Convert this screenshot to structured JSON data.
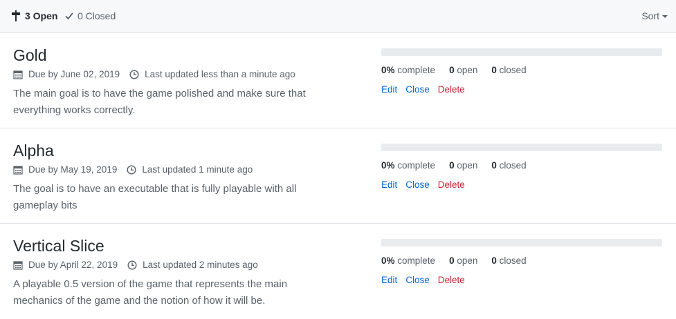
{
  "header": {
    "open_label": "3 Open",
    "closed_label": "0 Closed",
    "sort_label": "Sort"
  },
  "milestones": [
    {
      "title": "Gold",
      "due": "Due by June 02, 2019",
      "updated": "Last updated less than a minute ago",
      "description": "The main goal is to have the game polished and make sure that everything works correctly.",
      "progress": 0,
      "percent_label": "0%",
      "complete_label": "complete",
      "open_count": "0",
      "open_label": "open",
      "closed_count": "0",
      "closed_label": "closed",
      "edit": "Edit",
      "close": "Close",
      "delete": "Delete"
    },
    {
      "title": "Alpha",
      "due": "Due by May 19, 2019",
      "updated": "Last updated 1 minute ago",
      "description": "The goal is to have an executable that is fully playable with all gameplay bits",
      "progress": 0,
      "percent_label": "0%",
      "complete_label": "complete",
      "open_count": "0",
      "open_label": "open",
      "closed_count": "0",
      "closed_label": "closed",
      "edit": "Edit",
      "close": "Close",
      "delete": "Delete"
    },
    {
      "title": "Vertical Slice",
      "due": "Due by April 22, 2019",
      "updated": "Last updated 2 minutes ago",
      "description": "A playable 0.5 version of the game that represents the main mechanics of the game and the notion of how it will be.",
      "progress": 0,
      "percent_label": "0%",
      "complete_label": "complete",
      "open_count": "0",
      "open_label": "open",
      "closed_count": "0",
      "closed_label": "closed",
      "edit": "Edit",
      "close": "Close",
      "delete": "Delete"
    }
  ],
  "icons": {
    "open": "milestone-icon",
    "closed": "check-icon",
    "due": "calendar-icon",
    "updated": "clock-icon"
  },
  "colors": {
    "link": "#0366d6",
    "danger": "#cb2431",
    "progress_track": "#e9ecef",
    "progress_fill": "#28a745"
  }
}
